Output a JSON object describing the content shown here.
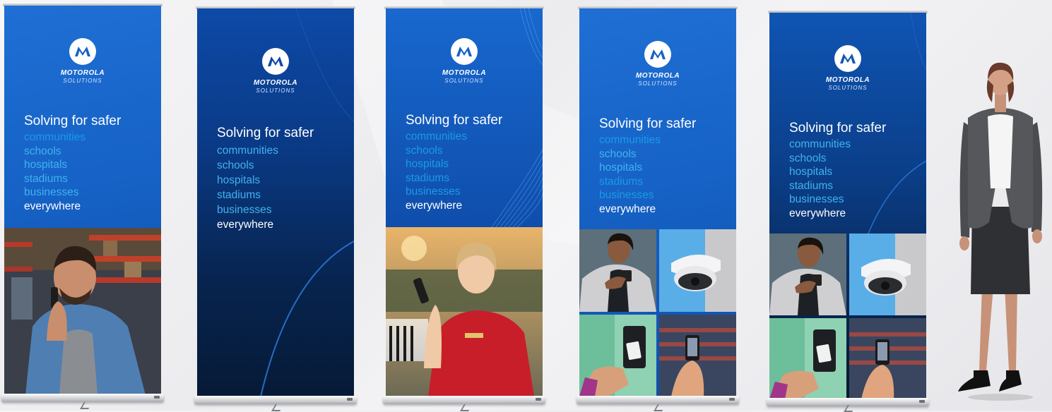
{
  "brand": {
    "logo_text": "MOTOROLA",
    "logo_subtext": "SOLUTIONS",
    "logo_icon": "motorola-m-batwing-icon"
  },
  "headline": "Solving for safer",
  "lines": [
    "communities",
    "schools",
    "hospitals",
    "stadiums",
    "businesses",
    "everywhere"
  ],
  "colors": {
    "brand_blue": "#1662c6",
    "dark_navy": "#061a36",
    "line_cyan": "#3fb3ef",
    "highlight_white": "#ffffff"
  },
  "banners": [
    {
      "variant": "blue top with warehouse worker photo",
      "photo": "man-with-radio-warehouse"
    },
    {
      "variant": "full navy gradient, no photo",
      "photo": ""
    },
    {
      "variant": "blue top with event staff photo",
      "photo": "woman-with-radio-red-dress"
    },
    {
      "variant": "blue top with four-image grid",
      "photo": "four-image-grid"
    },
    {
      "variant": "dark navy top with four-image grid",
      "photo": "four-image-grid"
    }
  ],
  "scale_figure": "woman-in-business-suit"
}
